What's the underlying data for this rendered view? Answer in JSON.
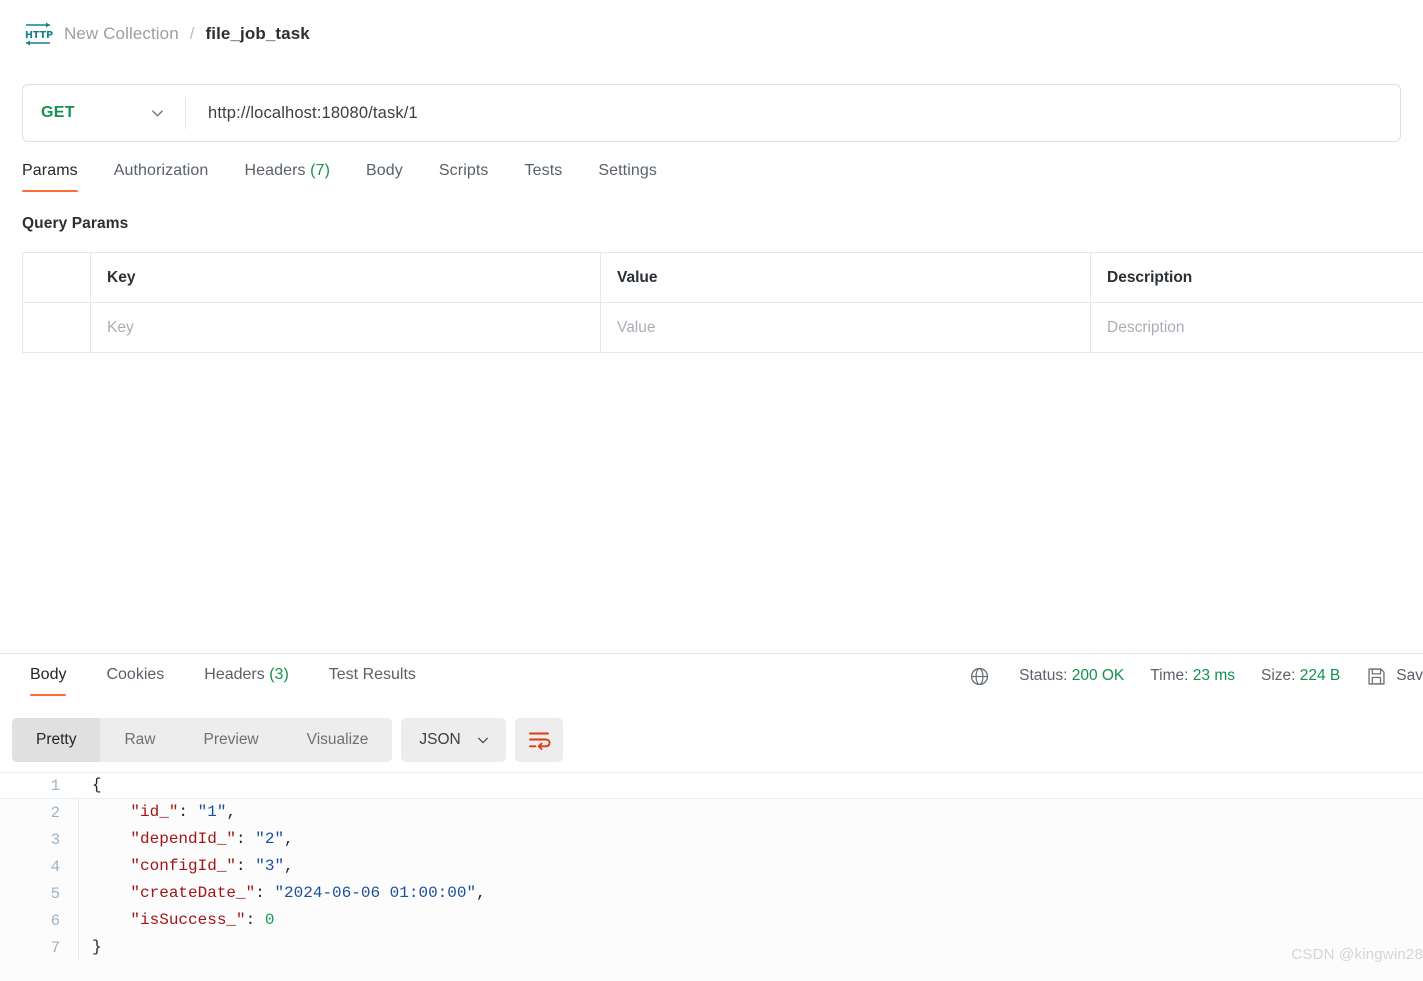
{
  "breadcrumb": {
    "icon": "http-protocol-icon",
    "collection": "New Collection",
    "separator": "/",
    "current": "file_job_task"
  },
  "request": {
    "method": "GET",
    "url": "http://localhost:18080/task/1",
    "tabs": [
      {
        "label": "Params",
        "count": "",
        "active": true
      },
      {
        "label": "Authorization",
        "count": "",
        "active": false
      },
      {
        "label": "Headers",
        "count": "(7)",
        "active": false
      },
      {
        "label": "Body",
        "count": "",
        "active": false
      },
      {
        "label": "Scripts",
        "count": "",
        "active": false
      },
      {
        "label": "Tests",
        "count": "",
        "active": false
      },
      {
        "label": "Settings",
        "count": "",
        "active": false
      }
    ]
  },
  "query_params": {
    "section_title": "Query Params",
    "columns": [
      "",
      "Key",
      "Value",
      "Description"
    ],
    "rows": [
      {
        "check": "",
        "key": "Key",
        "value": "Value",
        "description": "Description"
      }
    ]
  },
  "response": {
    "tabs": [
      {
        "label": "Body",
        "count": "",
        "active": true
      },
      {
        "label": "Cookies",
        "count": "",
        "active": false
      },
      {
        "label": "Headers",
        "count": "(3)",
        "active": false
      },
      {
        "label": "Test Results",
        "count": "",
        "active": false
      }
    ],
    "meta": {
      "globe_icon": "globe-icon",
      "status_label": "Status:",
      "status_value": "200 OK",
      "time_label": "Time:",
      "time_value": "23 ms",
      "size_label": "Size:",
      "size_value": "224 B",
      "save_icon": "save-floppy-icon",
      "save_label": "Sav"
    },
    "view_modes": [
      {
        "label": "Pretty",
        "active": true
      },
      {
        "label": "Raw",
        "active": false
      },
      {
        "label": "Preview",
        "active": false
      },
      {
        "label": "Visualize",
        "active": false
      }
    ],
    "format": "JSON",
    "wrap_icon": "wrap-text-icon",
    "body_lines": [
      {
        "n": "1",
        "current": true,
        "tokens": [
          {
            "t": "{",
            "c": "jp"
          }
        ]
      },
      {
        "n": "2",
        "current": false,
        "tokens": [
          {
            "t": "    ",
            "c": "jp"
          },
          {
            "t": "\"id_\"",
            "c": "jk"
          },
          {
            "t": ": ",
            "c": "jp"
          },
          {
            "t": "\"1\"",
            "c": "js"
          },
          {
            "t": ",",
            "c": "jp"
          }
        ]
      },
      {
        "n": "3",
        "current": false,
        "tokens": [
          {
            "t": "    ",
            "c": "jp"
          },
          {
            "t": "\"dependId_\"",
            "c": "jk"
          },
          {
            "t": ": ",
            "c": "jp"
          },
          {
            "t": "\"2\"",
            "c": "js"
          },
          {
            "t": ",",
            "c": "jp"
          }
        ]
      },
      {
        "n": "4",
        "current": false,
        "tokens": [
          {
            "t": "    ",
            "c": "jp"
          },
          {
            "t": "\"configId_\"",
            "c": "jk"
          },
          {
            "t": ": ",
            "c": "jp"
          },
          {
            "t": "\"3\"",
            "c": "js"
          },
          {
            "t": ",",
            "c": "jp"
          }
        ]
      },
      {
        "n": "5",
        "current": false,
        "tokens": [
          {
            "t": "    ",
            "c": "jp"
          },
          {
            "t": "\"createDate_\"",
            "c": "jk"
          },
          {
            "t": ": ",
            "c": "jp"
          },
          {
            "t": "\"2024-06-06 01:00:00\"",
            "c": "js"
          },
          {
            "t": ",",
            "c": "jp"
          }
        ]
      },
      {
        "n": "6",
        "current": false,
        "tokens": [
          {
            "t": "    ",
            "c": "jp"
          },
          {
            "t": "\"isSuccess_\"",
            "c": "jk"
          },
          {
            "t": ": ",
            "c": "jp"
          },
          {
            "t": "0",
            "c": "jn"
          }
        ]
      },
      {
        "n": "7",
        "current": false,
        "tokens": [
          {
            "t": "}",
            "c": "jp"
          }
        ]
      }
    ]
  },
  "watermark": "CSDN @kingwin28",
  "colors": {
    "accent": "#ff6c37",
    "success": "#12924b",
    "icon_teal": "#17808f",
    "json_key": "#a31515",
    "json_string": "#1a4f9c",
    "json_number": "#0f9d58"
  }
}
